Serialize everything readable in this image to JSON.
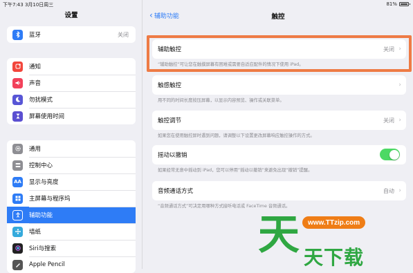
{
  "status_bar": {
    "time": "下午7:43  3月10日周三",
    "battery": "81%"
  },
  "sidebar": {
    "title": "设置",
    "groups": [
      [
        {
          "label": "蓝牙",
          "value": "关闭",
          "icon": "bluetooth-icon",
          "color": "#2e7cf6"
        }
      ],
      [
        {
          "label": "通知",
          "icon": "notification-icon",
          "color": "#f2463c"
        },
        {
          "label": "声音",
          "icon": "speaker-icon",
          "color": "#f2415a"
        },
        {
          "label": "勿扰模式",
          "icon": "moon-icon",
          "color": "#5856d6"
        },
        {
          "label": "屏幕使用时间",
          "icon": "hourglass-icon",
          "color": "#5b4fd1"
        }
      ],
      [
        {
          "label": "通用",
          "icon": "gear-icon",
          "color": "#8e8e93"
        },
        {
          "label": "控制中心",
          "icon": "control-center-icon",
          "color": "#8e8e93"
        },
        {
          "label": "显示与亮度",
          "icon": "display-icon",
          "color": "#2e7cf6"
        },
        {
          "label": "主屏幕与程序坞",
          "icon": "home-screen-icon",
          "color": "#2e7cf6"
        },
        {
          "label": "辅助功能",
          "icon": "accessibility-icon",
          "color": "#2e7cf6",
          "selected": true
        },
        {
          "label": "墙纸",
          "icon": "wallpaper-icon",
          "color": "#35aadc"
        },
        {
          "label": "Siri与搜索",
          "icon": "siri-icon",
          "color": "#222222"
        },
        {
          "label": "Apple Pencil",
          "icon": "pencil-icon",
          "color": "#555555"
        }
      ]
    ]
  },
  "detail": {
    "back_label": "辅助功能",
    "title": "触控",
    "cells": [
      {
        "label": "辅助触控",
        "value": "关闭",
        "note": "“辅助触控”可让您在触摸屏幕有困难或需要自适应配件的情况下使用 iPad。"
      },
      {
        "label": "触感触控",
        "value": "",
        "note": "用不同的时间长度按压屏幕，以显示内容预览、操作或关联菜单。"
      },
      {
        "label": "触控调节",
        "value": "关闭",
        "note": "如果您在使用触控屏时遇到问题，请调整以下设置更改屏幕响应触控操作的方式。"
      },
      {
        "label": "摇动以撤销",
        "toggle_on": true,
        "note": "如果经常无意中摇动到 iPad，您可以停用“摇动以撤销”来避免出现“撤销”提醒。"
      },
      {
        "label": "音频通话方式",
        "value": "自动",
        "note": "“音频通话方式”可决定用哪种方式接听电话或 FaceTime 音频通话。"
      }
    ]
  },
  "watermark": {
    "url": "www.TTzip.com",
    "logo_char": "天",
    "text": "天下载"
  },
  "colors": {
    "accent": "#2e7cf6",
    "highlight": "#ee7b45",
    "toggle_on": "#4cd964",
    "watermark": "#2fa742"
  }
}
